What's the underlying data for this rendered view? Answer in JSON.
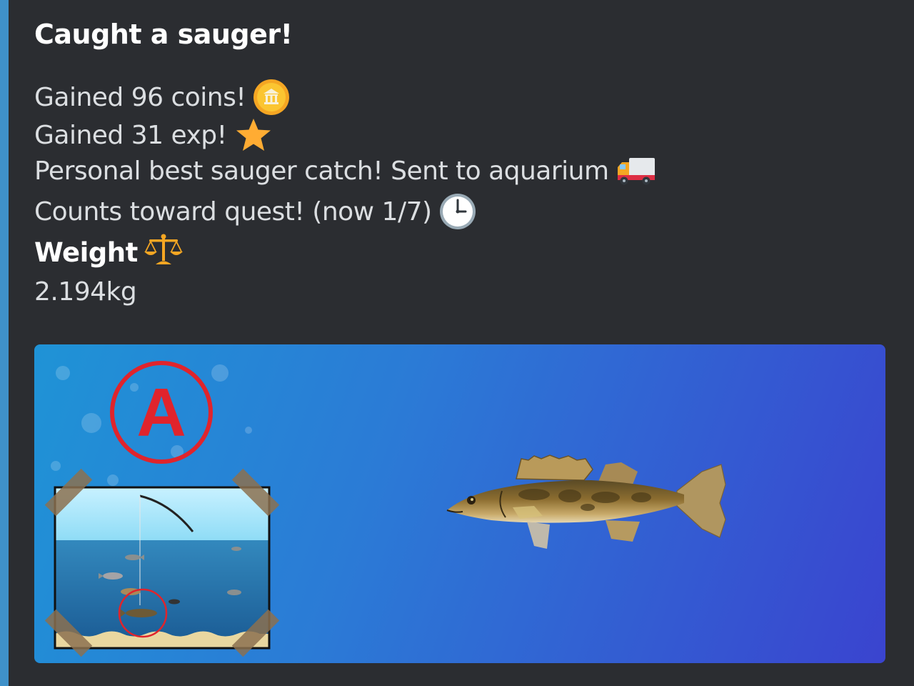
{
  "embed": {
    "title": "Caught a sauger!",
    "lines": [
      {
        "text": "Gained 96 coins!",
        "icon": "coin-icon"
      },
      {
        "text": "Gained 31 exp!",
        "icon": "star-icon"
      },
      {
        "text": "Personal best sauger catch! Sent to aquarium",
        "icon": "truck-icon"
      },
      {
        "text": "Counts toward quest! (now 1/7)",
        "icon": "clock-icon"
      }
    ],
    "field": {
      "name": "Weight",
      "icon": "scales-icon",
      "value": "2.194kg"
    }
  },
  "image": {
    "badge_letter": "A",
    "scene_icon": "fishing-scene-thumbnail",
    "fish_icon": "sauger-fish"
  },
  "colors": {
    "background": "#2b2d31",
    "accent": "#3f91c9",
    "badge": "#e0242c"
  }
}
